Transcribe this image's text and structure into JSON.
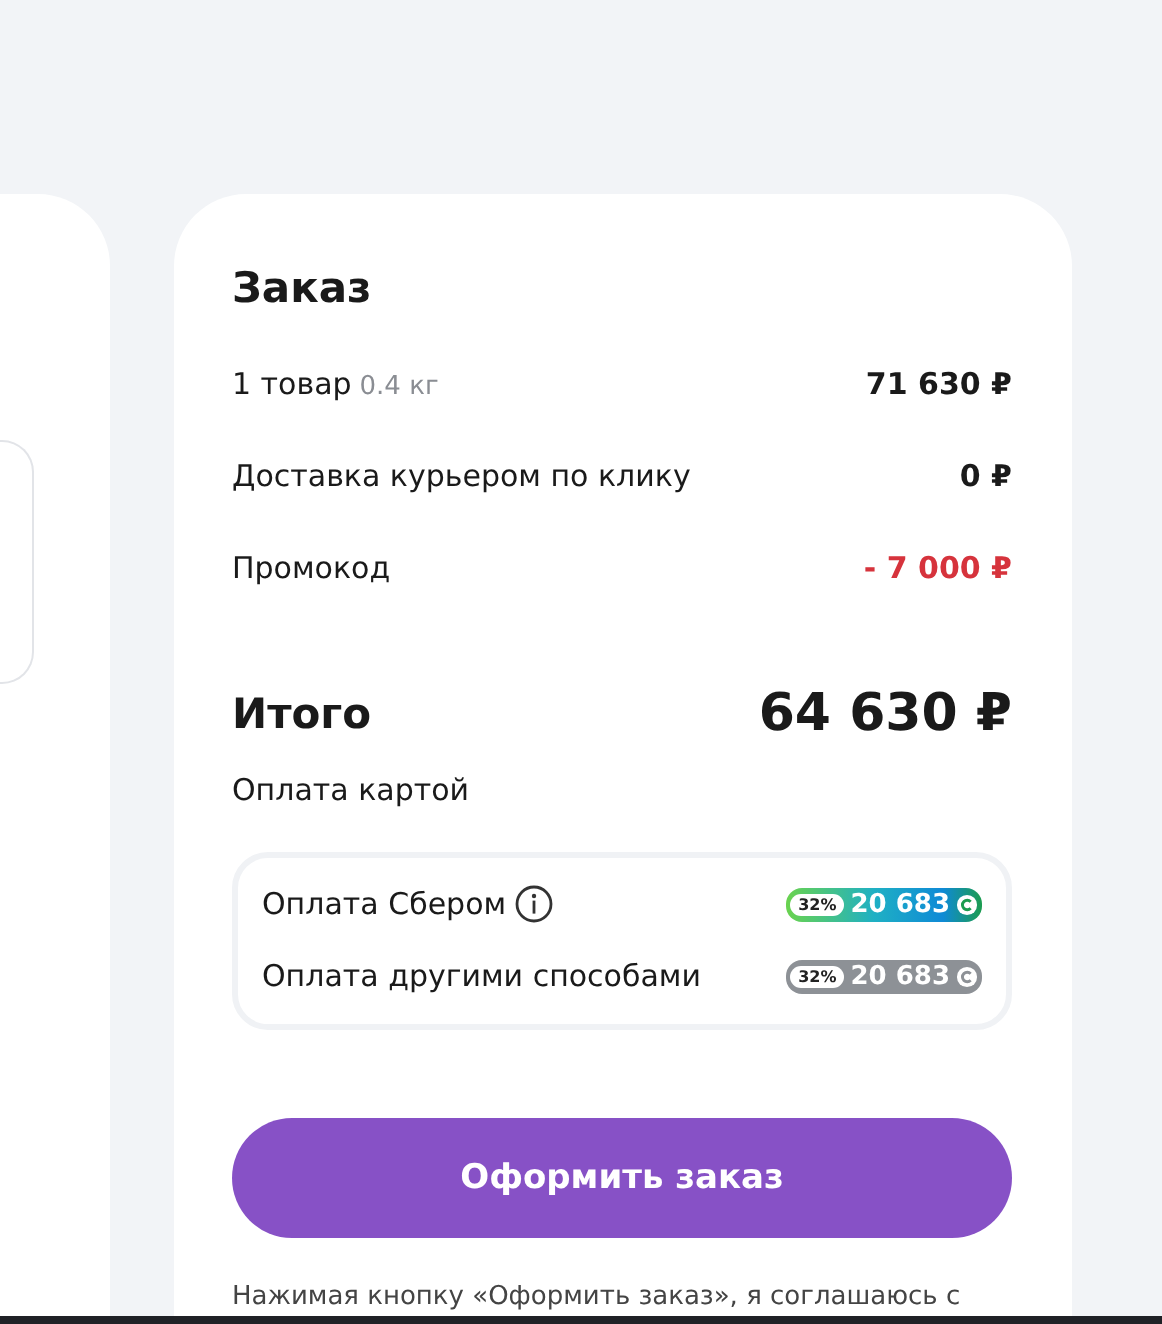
{
  "order": {
    "title": "Заказ",
    "lines": [
      {
        "label": "1 товар",
        "note": "0.4 кг",
        "amount": "71 630 ₽",
        "kind": "normal"
      },
      {
        "label": "Доставка курьером по клику",
        "amount": "0 ₽",
        "kind": "normal"
      },
      {
        "label": "Промокод",
        "amount": "- 7 000 ₽",
        "kind": "discount"
      }
    ],
    "total": {
      "label": "Итого",
      "amount": "64 630 ₽"
    },
    "payment_label": "Оплата картой",
    "payment_options": [
      {
        "label": "Оплата Сбером",
        "info": true,
        "percent": "32%",
        "bonus": "20 683",
        "kind": "sber"
      },
      {
        "label": "Оплата другими способами",
        "info": false,
        "percent": "32%",
        "bonus": "20 683",
        "kind": "other"
      }
    ],
    "submit": "Оформить заказ",
    "agreement": "Нажимая кнопку «Оформить заказ», я соглашаюсь с"
  }
}
